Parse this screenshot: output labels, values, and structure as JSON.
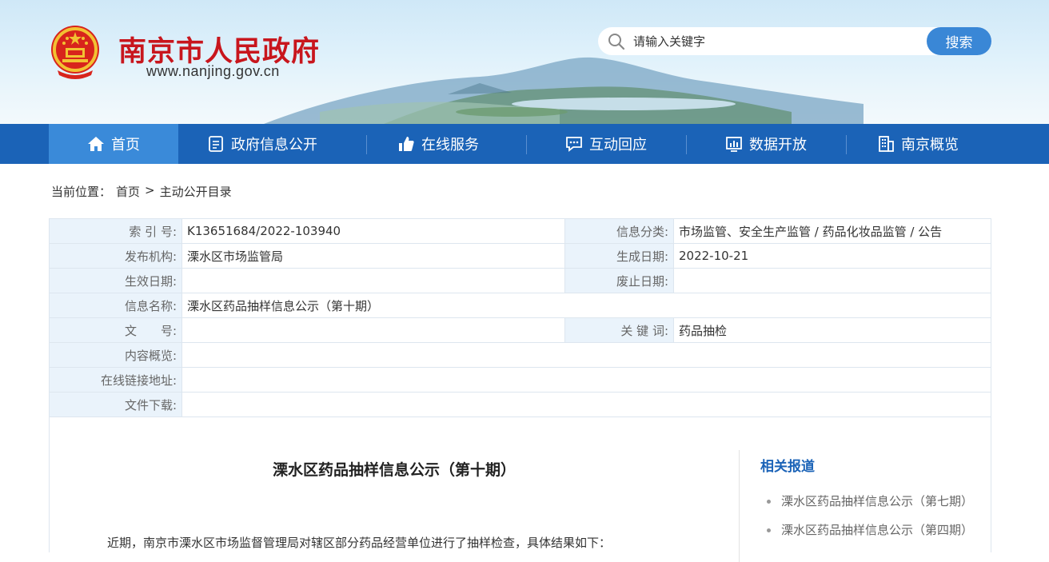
{
  "header": {
    "site_title": "南京市人民政府",
    "site_url": "www.nanjing.gov.cn",
    "search_placeholder": "请输入关键字",
    "search_button": "搜索"
  },
  "nav": {
    "items": [
      {
        "label": "首页",
        "icon": "home-icon"
      },
      {
        "label": "政府信息公开",
        "icon": "document-icon"
      },
      {
        "label": "在线服务",
        "icon": "thumbs-up-icon"
      },
      {
        "label": "互动回应",
        "icon": "chat-icon"
      },
      {
        "label": "数据开放",
        "icon": "chart-icon"
      },
      {
        "label": "南京概览",
        "icon": "building-icon"
      }
    ]
  },
  "breadcrumb": {
    "prefix": "当前位置：",
    "home": "首页",
    "separator": ">",
    "current": "主动公开目录"
  },
  "info": {
    "index_label": "索 引 号:",
    "index_value": "K13651684/2022-103940",
    "category_label": "信息分类:",
    "category_value": "市场监管、安全生产监管 / 药品化妆品监管 / 公告",
    "publisher_label": "发布机构:",
    "publisher_value": "溧水区市场监管局",
    "created_label": "生成日期:",
    "created_value": "2022-10-21",
    "effective_label": "生效日期:",
    "effective_value": "",
    "abolished_label": "废止日期:",
    "abolished_value": "",
    "name_label": "信息名称:",
    "name_value": "溧水区药品抽样信息公示（第十期）",
    "docno_label": "文　　号:",
    "docno_value": "",
    "keywords_label": "关 键 词:",
    "keywords_value": "药品抽检",
    "summary_label": "内容概览:",
    "summary_value": "",
    "link_label": "在线链接地址:",
    "link_value": "",
    "download_label": "文件下载:",
    "download_value": ""
  },
  "article": {
    "title": "溧水区药品抽样信息公示（第十期）",
    "intro": "近期，南京市溧水区市场监督管理局对辖区部分药品经营单位进行了抽样检查，具体结果如下："
  },
  "related": {
    "title": "相关报道",
    "items": [
      "溧水区药品抽样信息公示（第七期）",
      "溧水区药品抽样信息公示（第四期）"
    ]
  },
  "colors": {
    "brand_red": "#c8161d",
    "nav_blue": "#1b63b7",
    "nav_active": "#3a8ad9",
    "search_button": "#3a87d6",
    "table_label_bg": "#eaf3fb"
  }
}
